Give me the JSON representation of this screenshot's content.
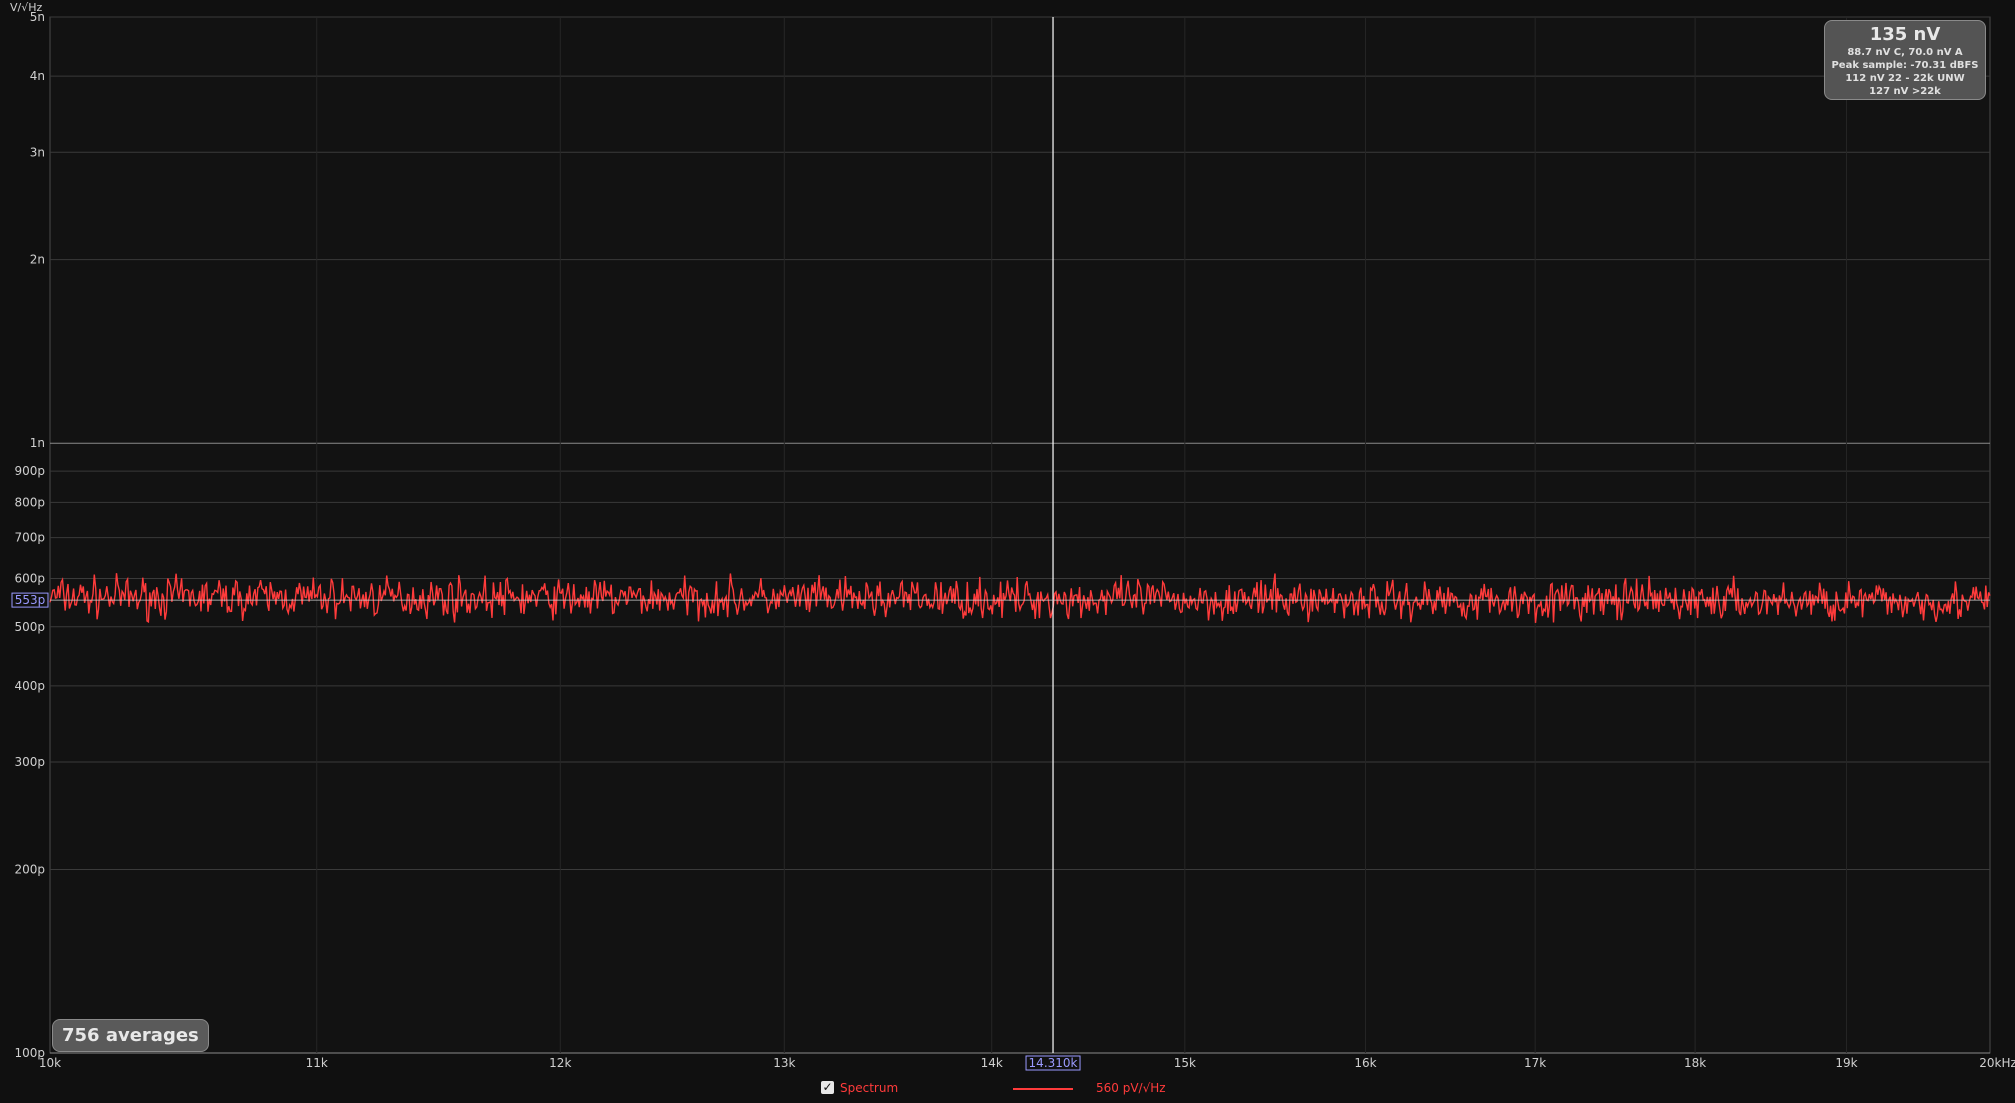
{
  "chart_data": {
    "type": "line",
    "y_unit_label": "V/√Hz",
    "x_scale": "log",
    "y_scale": "log",
    "xlim": [
      10000,
      20000
    ],
    "ylim": [
      1e-10,
      5e-09
    ],
    "x_ticks": [
      {
        "v": 10000,
        "label": "10k"
      },
      {
        "v": 11000,
        "label": "11k"
      },
      {
        "v": 12000,
        "label": "12k"
      },
      {
        "v": 13000,
        "label": "13k"
      },
      {
        "v": 14000,
        "label": "14k"
      },
      {
        "v": 15000,
        "label": "15k"
      },
      {
        "v": 16000,
        "label": "16k"
      },
      {
        "v": 17000,
        "label": "17k"
      },
      {
        "v": 18000,
        "label": "18k"
      },
      {
        "v": 19000,
        "label": "19k"
      },
      {
        "v": 20000,
        "label": "20kHz"
      }
    ],
    "y_ticks": [
      {
        "v": 5e-09,
        "label": "5n"
      },
      {
        "v": 4e-09,
        "label": "4n"
      },
      {
        "v": 3e-09,
        "label": "3n"
      },
      {
        "v": 2e-09,
        "label": "2n"
      },
      {
        "v": 1e-09,
        "label": "1n"
      },
      {
        "v": 9e-10,
        "label": "900p"
      },
      {
        "v": 8e-10,
        "label": "800p"
      },
      {
        "v": 7e-10,
        "label": "700p"
      },
      {
        "v": 6e-10,
        "label": "600p"
      },
      {
        "v": 5e-10,
        "label": "500p"
      },
      {
        "v": 4e-10,
        "label": "400p"
      },
      {
        "v": 3e-10,
        "label": "300p"
      },
      {
        "v": 2e-10,
        "label": "200p"
      },
      {
        "v": 1e-10,
        "label": "100p"
      }
    ],
    "grid": true,
    "cursor": {
      "x": 14310,
      "x_label": "14.310k",
      "y": 5.53e-10,
      "y_label": "553p"
    },
    "series": [
      {
        "name": "Spectrum",
        "color": "#ff3b3b",
        "level": 5.6e-10,
        "level_label": "560 pV/√Hz",
        "description_points": [
          [
            10000,
            5.6e-10
          ],
          [
            12000,
            5.6e-10
          ],
          [
            14000,
            5.55e-10
          ],
          [
            16000,
            5.52e-10
          ],
          [
            18000,
            5.5e-10
          ],
          [
            20000,
            5.48e-10
          ]
        ]
      }
    ]
  },
  "stats_box": {
    "total": "135 nV",
    "line1": "88.7 nV C, 70.0 nV A",
    "line2": "Peak sample: -70.31 dBFS",
    "line3": "112 nV 22 - 22k UNW",
    "line4": "127 nV >22k"
  },
  "averages_label": "756 averages",
  "legend": {
    "checked": true,
    "name": "Spectrum",
    "value": "560 pV/√Hz"
  },
  "colors": {
    "background": "#101010",
    "grid": "#3a3a3a",
    "trace": "#ff3b3b",
    "cursor": "#ffffff",
    "cursor_label": "#9a9aff"
  }
}
